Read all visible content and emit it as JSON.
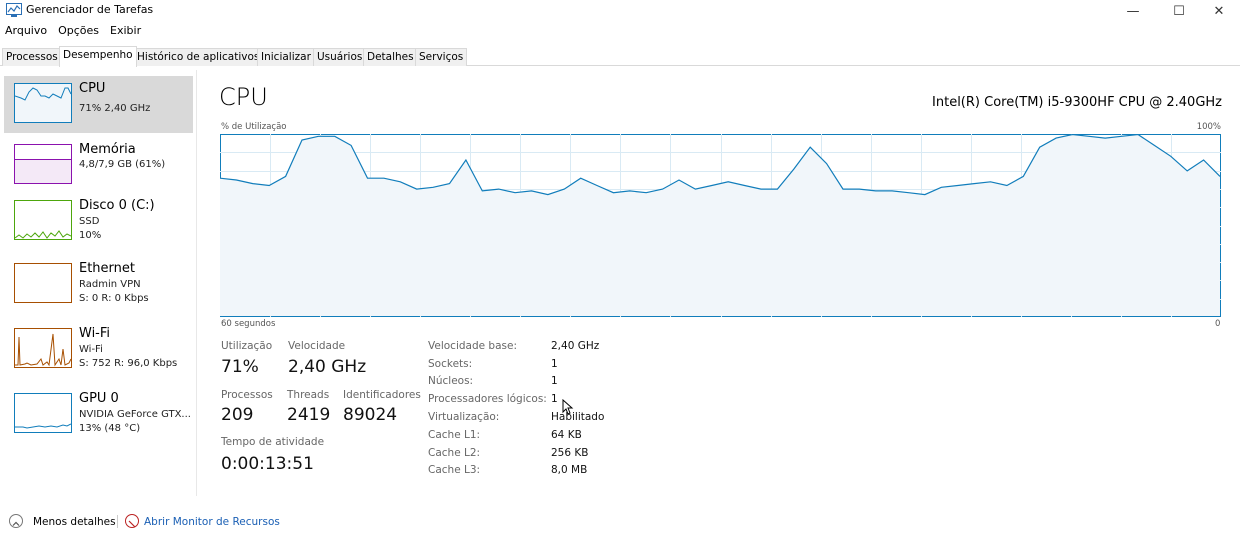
{
  "window": {
    "title": "Gerenciador de Tarefas",
    "minimize": "—",
    "maximize": "☐",
    "close": "✕"
  },
  "menu": [
    "Arquivo",
    "Opções",
    "Exibir"
  ],
  "tabs": [
    "Processos",
    "Desempenho",
    "Histórico de aplicativos",
    "Inicializar",
    "Usuários",
    "Detalhes",
    "Serviços"
  ],
  "sidebar": {
    "items": [
      {
        "name": "CPU",
        "lines": [
          "71% 2,40 GHz"
        ]
      },
      {
        "name": "Memória",
        "lines": [
          "4,8/7,9 GB (61%)"
        ]
      },
      {
        "name": "Disco 0 (C:)",
        "lines": [
          "SSD",
          "10%"
        ]
      },
      {
        "name": "Ethernet",
        "lines": [
          "Radmin VPN",
          "S: 0 R: 0 Kbps"
        ]
      },
      {
        "name": "Wi-Fi",
        "lines": [
          "Wi-Fi",
          "S: 752 R: 96,0 Kbps"
        ]
      },
      {
        "name": "GPU 0",
        "lines": [
          "NVIDIA GeForce GTX...",
          "13% (48 °C)"
        ]
      }
    ]
  },
  "main": {
    "title": "CPU",
    "model": "Intel(R) Core(TM) i5-9300HF CPU @ 2.40GHz",
    "graph_top_left": "% de Utilização",
    "graph_top_right": "100%",
    "graph_bottom_left": "60 segundos",
    "graph_bottom_right": "0",
    "stats": {
      "util_label": "Utilização",
      "util_value": "71%",
      "speed_label": "Velocidade",
      "speed_value": "2,40 GHz",
      "proc_label": "Processos",
      "proc_value": "209",
      "threads_label": "Threads",
      "threads_value": "2419",
      "handles_label": "Identificadores",
      "handles_value": "89024",
      "uptime_label": "Tempo de atividade",
      "uptime_value": "0:00:13:51"
    },
    "details": [
      {
        "label": "Velocidade base:",
        "value": "2,40 GHz"
      },
      {
        "label": "Sockets:",
        "value": "1"
      },
      {
        "label": "Núcleos:",
        "value": "1"
      },
      {
        "label": "Processadores lógicos:",
        "value": "1"
      },
      {
        "label": "Virtualização:",
        "value": "Habilitado"
      },
      {
        "label": "Cache L1:",
        "value": "64 KB"
      },
      {
        "label": "Cache L2:",
        "value": "256 KB"
      },
      {
        "label": "Cache L3:",
        "value": "8,0 MB"
      }
    ]
  },
  "footer": {
    "less_details": "Menos detalhes",
    "resource_monitor": "Abrir Monitor de Recursos"
  },
  "cpu_history_percent": [
    76,
    75,
    73,
    72,
    77,
    97,
    99,
    99,
    94,
    76,
    76,
    74,
    70,
    71,
    73,
    86,
    69,
    70,
    68,
    69,
    67,
    70,
    76,
    72,
    68,
    69,
    68,
    70,
    75,
    70,
    72,
    74,
    72,
    70,
    70,
    81,
    93,
    84,
    70,
    70,
    69,
    69,
    68,
    67,
    71,
    72,
    73,
    74,
    72,
    77,
    93,
    98,
    100,
    99,
    98,
    99,
    100,
    94,
    88,
    80,
    86,
    77
  ],
  "colors": {
    "cpu": "#117dbb",
    "memory": "#8b12ae",
    "disk": "#4da60c",
    "ethernet": "#a74f01",
    "wifi": "#a74f01",
    "gpu": "#117dbb"
  }
}
